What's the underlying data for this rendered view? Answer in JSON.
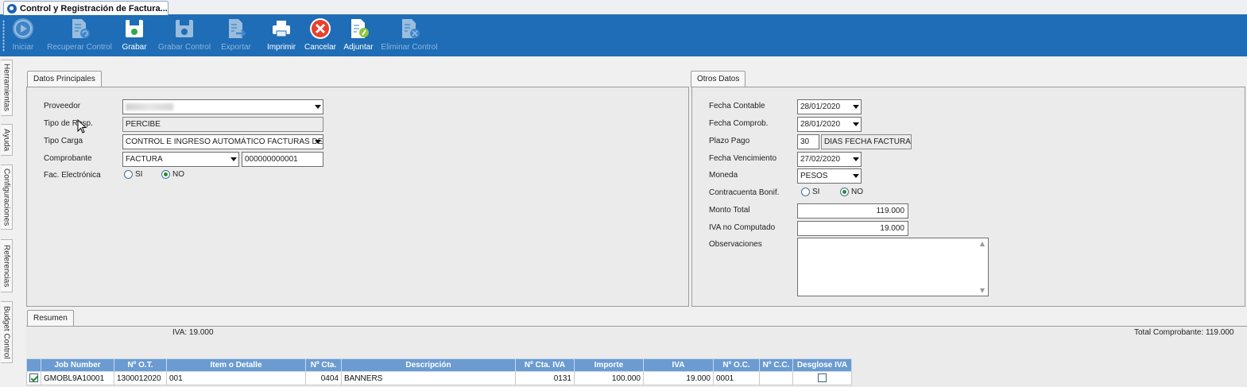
{
  "window": {
    "tab_title": "Control y Registración de Factura..."
  },
  "toolbar": {
    "buttons": [
      {
        "label": "Iniciar",
        "icon": "play-icon",
        "enabled": false
      },
      {
        "label": "Recuperar Control",
        "icon": "document-recover-icon",
        "enabled": false
      },
      {
        "label": "Grabar",
        "icon": "save-icon",
        "enabled": true
      },
      {
        "label": "Grabar Control",
        "icon": "save-control-icon",
        "enabled": false
      },
      {
        "label": "Exportar",
        "icon": "export-icon",
        "enabled": false
      },
      {
        "label": "Imprimir",
        "icon": "printer-icon",
        "enabled": true
      },
      {
        "label": "Cancelar",
        "icon": "cancel-icon",
        "enabled": true
      },
      {
        "label": "Adjuntar",
        "icon": "attach-icon",
        "enabled": true
      },
      {
        "label": "Eliminar Control",
        "icon": "delete-control-icon",
        "enabled": false
      }
    ]
  },
  "sidetabs": [
    "Herramientas",
    "Ayuda",
    "Configuraciones",
    "Referencias",
    "Budget Control"
  ],
  "datos_principales": {
    "tab": "Datos Principales",
    "proveedor": {
      "label": "Proveedor",
      "value": ""
    },
    "tipo_resp": {
      "label": "Tipo de Resp.",
      "value": "PERCIBE"
    },
    "tipo_carga": {
      "label": "Tipo Carga",
      "value": "CONTROL E INGRESO AUTOMÁTICO FACTURAS DE PRO"
    },
    "comprobante": {
      "label": "Comprobante",
      "tipo": "FACTURA",
      "numero": "000000000001"
    },
    "fac_electronica": {
      "label": "Fac. Electrónica",
      "si": "SI",
      "no": "NO",
      "selected": "NO"
    }
  },
  "otros_datos": {
    "tab": "Otros Datos",
    "fecha_contable": {
      "label": "Fecha Contable",
      "value": "28/01/2020"
    },
    "fecha_comprob": {
      "label": "Fecha Comprob.",
      "value": "28/01/2020"
    },
    "plazo_pago": {
      "label": "Plazo Pago",
      "dias": "30",
      "tipo": "DIAS FECHA FACTURA"
    },
    "fecha_vencimiento": {
      "label": "Fecha Vencimiento",
      "value": "27/02/2020"
    },
    "moneda": {
      "label": "Moneda",
      "value": "PESOS"
    },
    "contracuenta": {
      "label": "Contracuenta Bonif.",
      "si": "SI",
      "no": "NO",
      "selected": "NO"
    },
    "monto_total": {
      "label": "Monto Total",
      "value": "119.000"
    },
    "iva_no_computado": {
      "label": "IVA no Computado",
      "value": "19.000"
    },
    "observaciones": {
      "label": "Observaciones",
      "value": ""
    }
  },
  "resumen": {
    "tab": "Resumen",
    "iva": "IVA: 19.000",
    "total": "Total Comprobante: 119.000",
    "columns": [
      "Job Number",
      "Nº O.T.",
      "Item o Detalle",
      "Nº Cta.",
      "Descripción",
      "Nº Cta. IVA",
      "Importe",
      "IVA",
      "Nº O.C.",
      "Nº C.C.",
      "Desglose IVA"
    ],
    "rows": [
      {
        "checked": true,
        "job": "GMOBL9A10001",
        "ot": "1300012020",
        "item": "001",
        "cta": "0404",
        "descripcion": "BANNERS",
        "cta_iva": "0131",
        "importe": "100.000",
        "iva": "19.000",
        "oc": "0001",
        "cc": "",
        "desglose": false
      }
    ]
  }
}
